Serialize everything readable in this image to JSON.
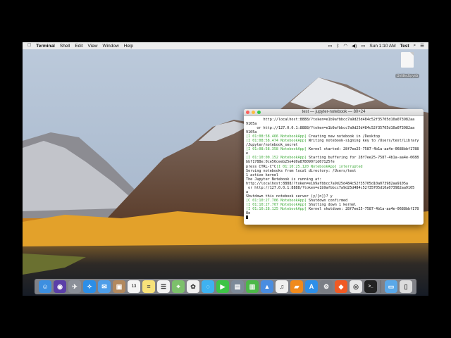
{
  "menubar": {
    "apple_icon": "apple-icon",
    "app_name": "Terminal",
    "items": [
      "Shell",
      "Edit",
      "View",
      "Window",
      "Help"
    ],
    "clock": "Sun 1:10 AM",
    "user": "Test"
  },
  "desktop_icon": {
    "label": "Untitled.ipynb"
  },
  "terminal": {
    "title": "test — jupyter-notebook — 80×24",
    "lines": [
      {
        "text": "        http://localhost:8888/?token=e1b9afbbcc7a9d25d484c52f35705d10a073982aa",
        "g": false
      },
      {
        "text": "9105a",
        "g": false
      },
      {
        "text": "     or http://127.0.0.1:8888/?token=e1b9afbbcc7a9d25d484c52f35705d10a073982aa",
        "g": false
      },
      {
        "text": "9105a",
        "g": false
      },
      {
        "pre": "[I 01:08:58.466 NotebookApp]",
        "text": " Creating new notebook in /Desktop",
        "g": true
      },
      {
        "pre": "[I 01:08:58.474 NotebookApp]",
        "text": " Writing notebook-signing key to /Users/test/Library",
        "g": true
      },
      {
        "text": "/Jupyter/notebook_secret",
        "g": false
      },
      {
        "pre": "[I 01:08:58.358 NotebookApp]",
        "text": " Kernel started: 28f7ee25-7587-4b1a-aa4e-0688bbf1788",
        "g": true
      },
      {
        "text": "e",
        "g": false
      },
      {
        "pre": "[I 01:10:00.152 NotebookApp]",
        "text": " Starting buffering for 28f7ee25-7587-4b1a-aa4e-0688",
        "g": true
      },
      {
        "text": "bbf1788e:0ce56ceeb25e4d0a878090f1d67125fe",
        "g": false
      },
      {
        "pre": "press CTRL-C^C",
        "text": "[I 01:10:25.120 NotebookApp] interrupted",
        "g": true,
        "mixed": true
      },
      {
        "text": "Serving notebooks from local directory: /Users/test",
        "g": false
      },
      {
        "text": "1 active kernel",
        "g": false
      },
      {
        "text": "The Jupyter Notebook is running at:",
        "g": false
      },
      {
        "text": "http://localhost:8888/?token=e1b9afbbcc7a9d25d484c52f35705d10a073982aa9105a",
        "g": false
      },
      {
        "text": " or http://127.0.0.1:8888/?token=e1b9afbbcc7a9d25d484c52f35705d10a073982aa9105",
        "g": false
      },
      {
        "text": "a",
        "g": false
      },
      {
        "text": "Shutdown this notebook server (y/[n])? y",
        "g": false
      },
      {
        "pre": "[C 01:10:27.706 NotebookApp]",
        "text": " Shutdown confirmed",
        "g": true
      },
      {
        "pre": "[I 01:10:27.707 NotebookApp]",
        "text": " Shutting down 1 kernel",
        "g": true
      },
      {
        "pre": "[I 01:10:28.125 NotebookApp]",
        "text": " Kernel shutdown: 28f7ee25-7587-4b1a-aa4e-0688bbf178",
        "g": true
      },
      {
        "text": "8e",
        "g": false
      }
    ]
  },
  "dock": {
    "items": [
      {
        "name": "finder-icon",
        "color": "#3d8fe0",
        "glyph": "☺"
      },
      {
        "name": "siri-icon",
        "color": "#5b3fa8",
        "glyph": "◉"
      },
      {
        "name": "launchpad-icon",
        "color": "#8a8f98",
        "glyph": "✈"
      },
      {
        "name": "safari-icon",
        "color": "#2c8ee6",
        "glyph": "✧"
      },
      {
        "name": "mail-icon",
        "color": "#4e9ee9",
        "glyph": "✉"
      },
      {
        "name": "contacts-icon",
        "color": "#b2895e",
        "glyph": "▣"
      },
      {
        "name": "calendar-icon",
        "color": "#f4f4f4",
        "glyph": "13",
        "dark": true
      },
      {
        "name": "notes-icon",
        "color": "#f7e27a",
        "glyph": "≡",
        "dark": true
      },
      {
        "name": "reminders-icon",
        "color": "#f2f2f2",
        "glyph": "☰",
        "dark": true
      },
      {
        "name": "maps-icon",
        "color": "#7cc06b",
        "glyph": "⌖"
      },
      {
        "name": "photos-icon",
        "color": "#f0f0f0",
        "glyph": "✿",
        "dark": true
      },
      {
        "name": "messages-icon",
        "color": "#3fb2f0",
        "glyph": "◌"
      },
      {
        "name": "facetime-icon",
        "color": "#3ec447",
        "glyph": "▶"
      },
      {
        "name": "photo-booth-icon",
        "color": "#7d8a99",
        "glyph": "▤"
      },
      {
        "name": "numbers-icon",
        "color": "#4cb848",
        "glyph": "▥"
      },
      {
        "name": "keynote-icon",
        "color": "#4a8de0",
        "glyph": "▲"
      },
      {
        "name": "itunes-icon",
        "color": "#f0f0f0",
        "glyph": "♫",
        "dark": true
      },
      {
        "name": "ibooks-icon",
        "color": "#f08a1c",
        "glyph": "▰"
      },
      {
        "name": "app-store-icon",
        "color": "#2e8fe8",
        "glyph": "A"
      },
      {
        "name": "system-preferences-icon",
        "color": "#7a7e85",
        "glyph": "⚙"
      },
      {
        "name": "brave-icon",
        "color": "#f05a24",
        "glyph": "◆"
      },
      {
        "name": "chrome-icon",
        "color": "#e8e8e8",
        "glyph": "◎",
        "dark": true
      },
      {
        "name": "terminal-icon",
        "color": "#222222",
        "glyph": ">_"
      }
    ],
    "right": [
      {
        "name": "downloads-folder-icon",
        "color": "#5aa8e8",
        "glyph": "▭"
      },
      {
        "name": "trash-icon",
        "color": "#dcdcdc",
        "glyph": "▯",
        "dark": true
      }
    ]
  }
}
